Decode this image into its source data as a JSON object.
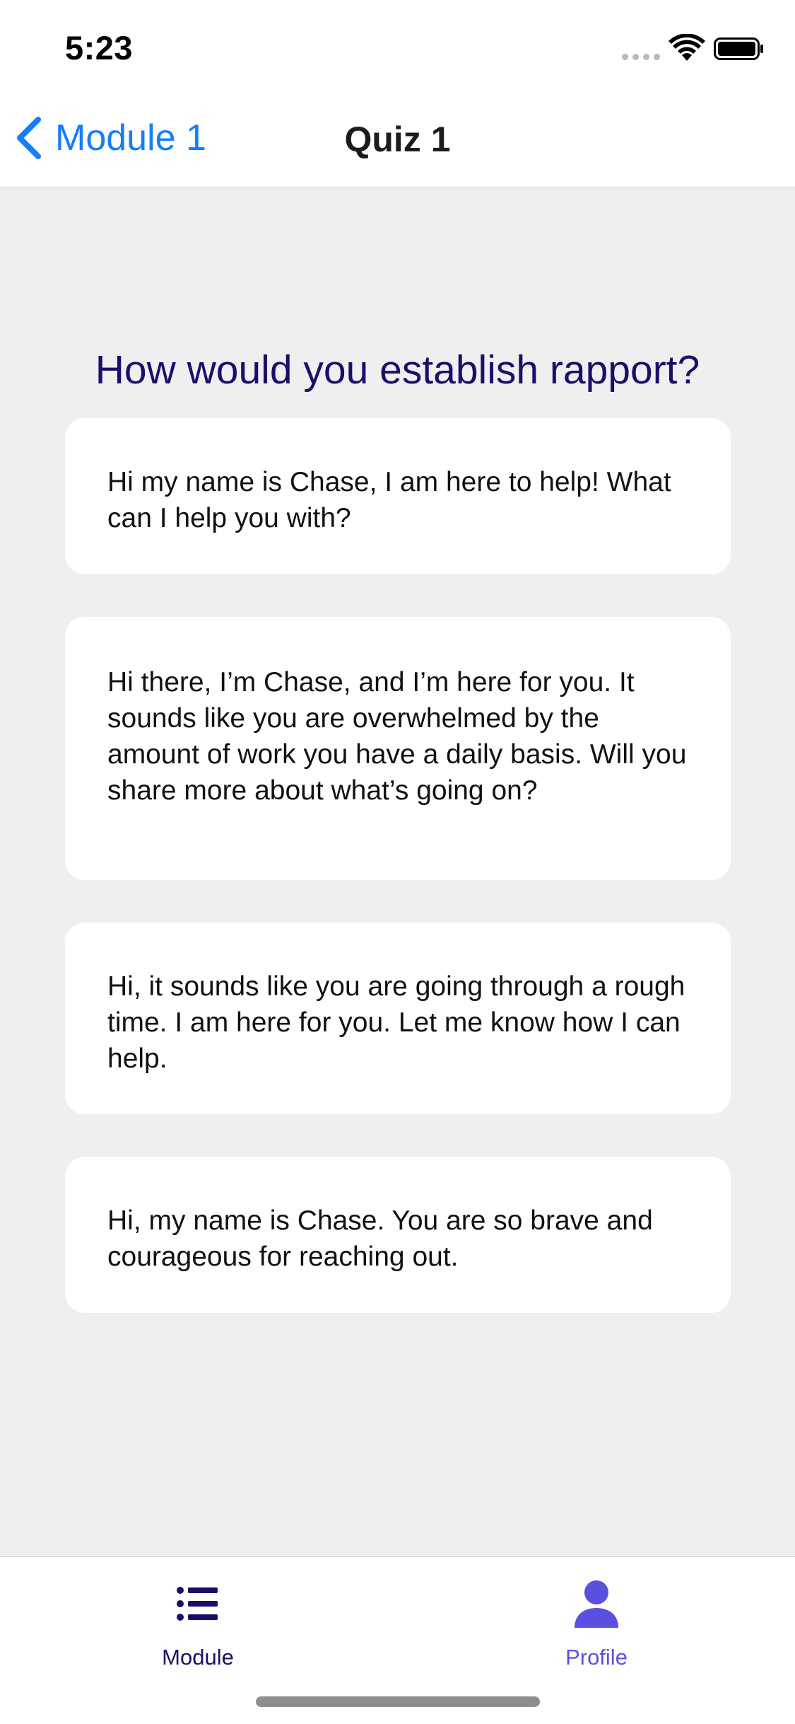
{
  "status_bar": {
    "time": "5:23"
  },
  "nav": {
    "back_label": "Module 1",
    "title": "Quiz 1"
  },
  "quiz": {
    "question": "How would you establish rapport?",
    "answers": [
      "Hi my name is Chase, I am here to help! What can I help you with?",
      "Hi there, I’m Chase, and I’m here for you. It sounds like you are overwhelmed by the amount of work you have a daily basis. Will you share more about what’s going on?",
      "Hi, it sounds like you are going through a rough time. I am here for you. Let me know how I can help.",
      "Hi, my name is Chase. You are so brave and courageous for reaching out."
    ]
  },
  "tabbar": {
    "tabs": [
      {
        "label": "Module",
        "icon": "list-icon"
      },
      {
        "label": "Profile",
        "icon": "person-icon"
      }
    ]
  },
  "colors": {
    "accent_blue": "#147efb",
    "question_navy": "#1b0e6b",
    "profile_purple": "#5a50e0",
    "background": "#efefef"
  }
}
